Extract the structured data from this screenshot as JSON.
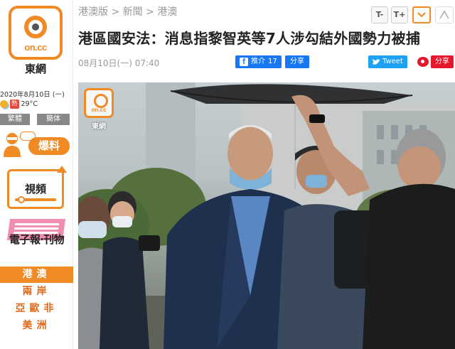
{
  "sidebar": {
    "logo_text": "on.cc",
    "brand": "東網",
    "date": "2020年8月10日 (一)",
    "weather": {
      "badge": "熱",
      "temp": "29°C"
    },
    "lang": {
      "traditional": "繁體",
      "simplified": "簡体"
    },
    "baoliao": "爆料",
    "video": "視頻",
    "epaper": "電子報‧刊物",
    "categories": [
      {
        "label": "港澳",
        "active": true
      },
      {
        "label": "兩岸",
        "active": false
      },
      {
        "label": "亞歐非",
        "active": false
      },
      {
        "label": "美洲",
        "active": false
      }
    ]
  },
  "breadcrumb": [
    "港澳版",
    "新聞",
    "港澳"
  ],
  "toolbar": {
    "font_smaller": "T-",
    "font_larger": "T+"
  },
  "article": {
    "headline": "港區國安法：消息指黎智英等7人涉勾結外國勢力被捕",
    "datetime": "08月10日(一) 07:40"
  },
  "share": {
    "fb_recommend": "推介",
    "fb_count": "17",
    "fb_share": "分享",
    "tweet": "Tweet",
    "weibo_share": "分享"
  },
  "photo": {
    "watermark_logo": "on.cc",
    "watermark_brand": "東網"
  },
  "colors": {
    "brand_orange": "#f08a24",
    "facebook": "#1877f2",
    "twitter": "#1da1f2",
    "weibo": "#e6162d"
  }
}
